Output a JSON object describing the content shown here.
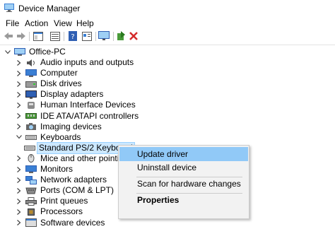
{
  "window": {
    "title": "Device Manager"
  },
  "menu": [
    "File",
    "Action",
    "View",
    "Help"
  ],
  "toolbar": {
    "buttons": [
      "back-arrow-icon",
      "forward-arrow-icon",
      "properties-panel-icon",
      "refresh-list-icon",
      "help-icon",
      "properties-icon",
      "monitor-scan-icon",
      "add-driver-icon",
      "uninstall-x-icon"
    ]
  },
  "tree": {
    "root": "Office-PC",
    "items": [
      {
        "label": "Audio inputs and outputs",
        "icon": "speaker-icon"
      },
      {
        "label": "Computer",
        "icon": "computer-icon"
      },
      {
        "label": "Disk drives",
        "icon": "disk-icon"
      },
      {
        "label": "Display adapters",
        "icon": "display-icon"
      },
      {
        "label": "Human Interface Devices",
        "icon": "hid-icon"
      },
      {
        "label": "IDE ATA/ATAPI controllers",
        "icon": "ide-icon"
      },
      {
        "label": "Imaging devices",
        "icon": "camera-icon"
      },
      {
        "label": "Keyboards",
        "icon": "keyboard-icon"
      },
      {
        "label": "Standard PS/2 Keyboard",
        "icon": "keyboard-icon"
      },
      {
        "label": "Mice and other pointing de",
        "icon": "mouse-icon"
      },
      {
        "label": "Monitors",
        "icon": "monitor-icon"
      },
      {
        "label": "Network adapters",
        "icon": "network-icon"
      },
      {
        "label": "Ports (COM & LPT)",
        "icon": "port-icon"
      },
      {
        "label": "Print queues",
        "icon": "printer-icon"
      },
      {
        "label": "Processors",
        "icon": "cpu-icon"
      },
      {
        "label": "Software devices",
        "icon": "software-icon"
      }
    ]
  },
  "context_menu": {
    "items": [
      "Update driver",
      "Uninstall device",
      "Scan for hardware changes",
      "Properties"
    ]
  },
  "colors": {
    "selection": "#cce8ff",
    "menu_highlight": "#91c9f7"
  }
}
